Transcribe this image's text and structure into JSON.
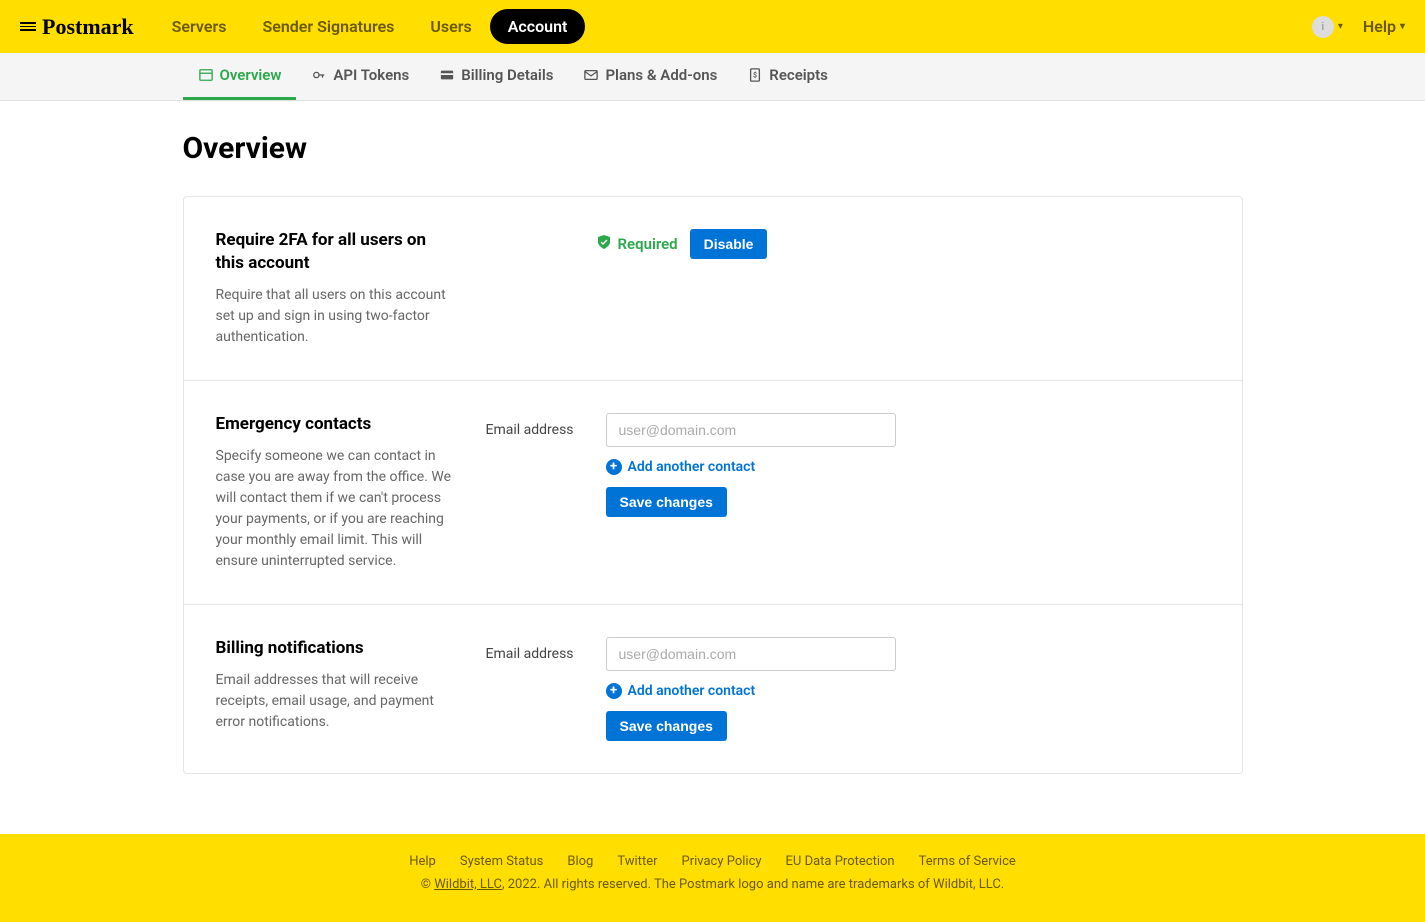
{
  "brand": "Postmark",
  "topnav": {
    "items": [
      "Servers",
      "Sender Signatures",
      "Users",
      "Account"
    ],
    "active_index": 3,
    "help_label": "Help"
  },
  "subnav": {
    "items": [
      {
        "label": "Overview",
        "icon": "card-icon"
      },
      {
        "label": "API Tokens",
        "icon": "key-icon"
      },
      {
        "label": "Billing Details",
        "icon": "creditcard-icon"
      },
      {
        "label": "Plans & Add-ons",
        "icon": "envelope-icon"
      },
      {
        "label": "Receipts",
        "icon": "receipt-icon"
      }
    ],
    "active_index": 0
  },
  "page": {
    "title": "Overview"
  },
  "sections": {
    "twofa": {
      "title": "Require 2FA for all users on this account",
      "desc": "Require that all users on this account set up and sign in using two-factor authentication.",
      "status": "Required",
      "button": "Disable"
    },
    "emergency": {
      "title": "Emergency contacts",
      "desc": "Specify someone we can contact in case you are away from the office. We will contact them if we can't process your payments, or if you are reaching your monthly email limit. This will ensure uninterrupted service.",
      "field_label": "Email address",
      "placeholder": "user@domain.com",
      "add_label": "Add another contact",
      "save_label": "Save changes"
    },
    "billing": {
      "title": "Billing notifications",
      "desc": "Email addresses that will receive receipts, email usage, and payment error notifications.",
      "field_label": "Email address",
      "placeholder": "user@domain.com",
      "add_label": "Add another contact",
      "save_label": "Save changes"
    }
  },
  "footer": {
    "links": [
      "Help",
      "System Status",
      "Blog",
      "Twitter",
      "Privacy Policy",
      "EU Data Protection",
      "Terms of Service"
    ],
    "company": "Wildbit, LLC",
    "copy_rest": ", 2022. All rights reserved. The Postmark logo and name are trademarks of Wildbit, LLC."
  }
}
